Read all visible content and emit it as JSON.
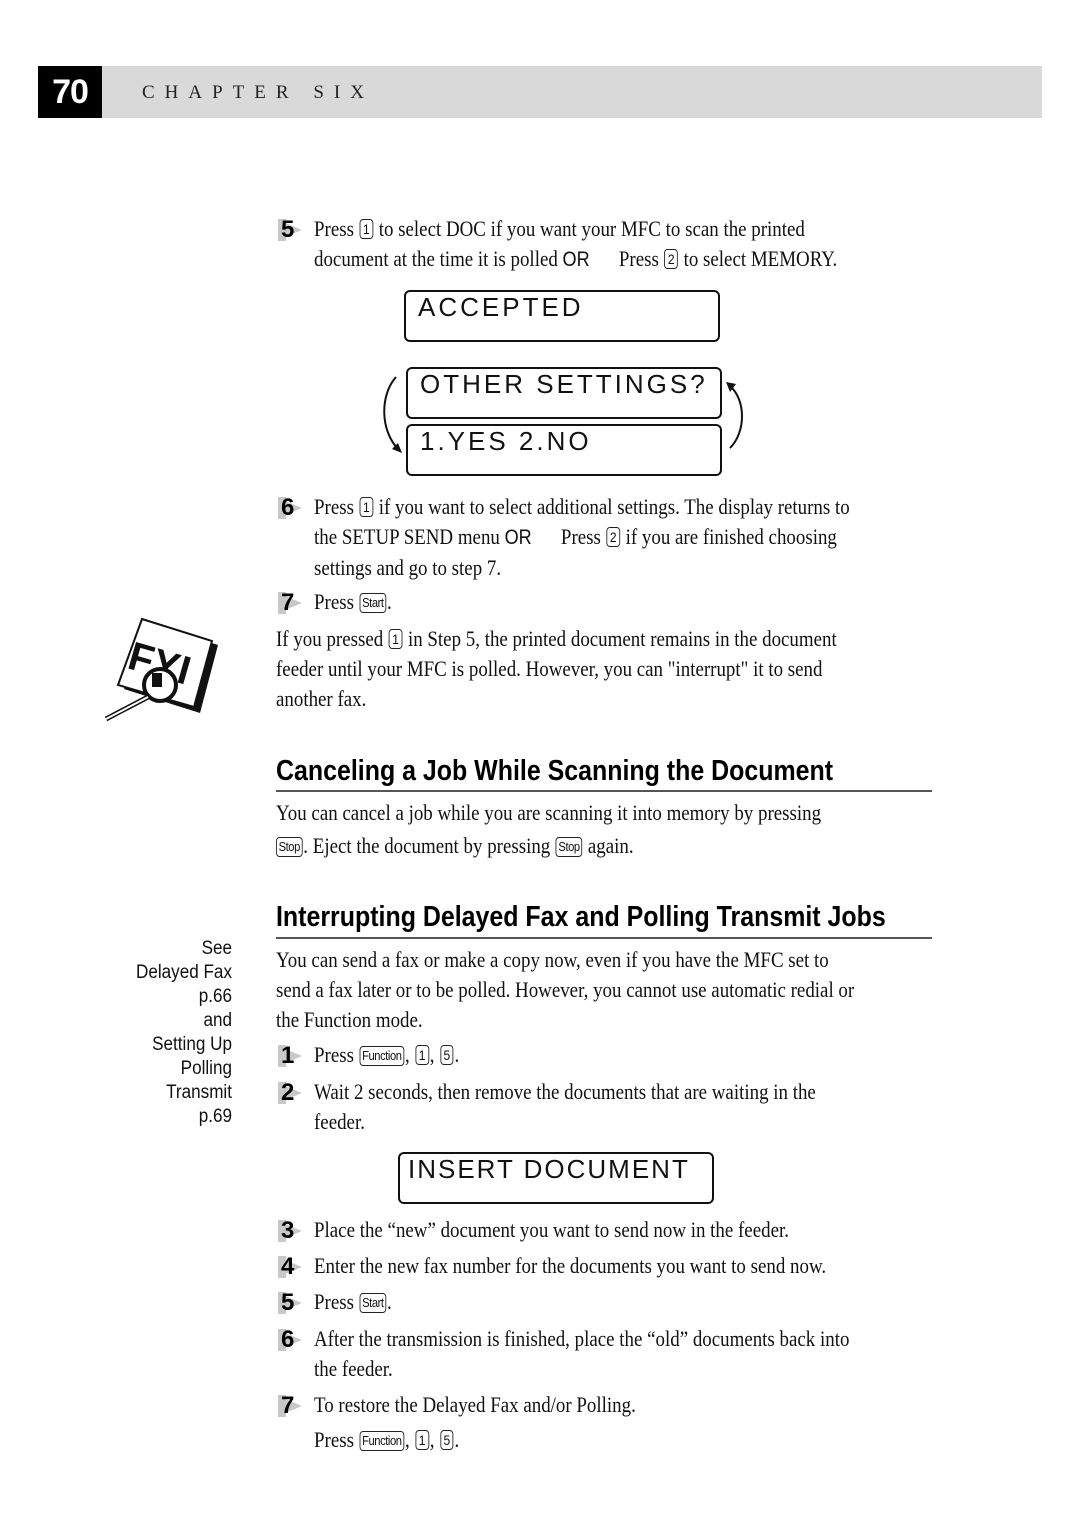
{
  "header": {
    "page_number": "70",
    "chapter_title": "CHAPTER SIX"
  },
  "section_polling": {
    "step5": {
      "number": "5",
      "line1_a": "Press",
      "key1": "1",
      "line1_b": "to select DOC if you want your MFC to scan the printed",
      "line2_a": "document at the time it is polled",
      "or": "OR",
      "line2_b": "Press",
      "key2": "2",
      "line2_c": "to select MEMORY."
    },
    "lcd_accepted": "ACCEPTED",
    "lcd_other_settings": "OTHER SETTINGS?",
    "lcd_yes_no": "1.YES 2.NO",
    "step6": {
      "number": "6",
      "line1_a": "Press",
      "key1": "1",
      "line1_b": "if you want to select additional settings. The display returns to",
      "line2_a": "the SETUP SEND menu",
      "or": "OR",
      "line2_b": "Press",
      "key2": "2",
      "line2_c": "if you are finished choosing",
      "line3": "settings and go to step 7."
    },
    "step7": {
      "number": "7",
      "press": "Press",
      "key": "Start",
      "end": "."
    },
    "fyi_icon": "fyi-magnifier-icon",
    "fyi_note": {
      "line1_a": "If you pressed",
      "key": "1",
      "line1_b": "in Step 5, the printed document remains in the document",
      "line2": "feeder until your MFC is polled.  However, you can \"interrupt\" it to send",
      "line3": "another fax."
    }
  },
  "section_cancel": {
    "heading": "Canceling a Job While Scanning the Document",
    "line1": "You can cancel a job while you are scanning it into memory by pressing",
    "key_stop": "Stop",
    "line2_a": ".  Eject the document by pressing",
    "line2_b": "again."
  },
  "section_interrupt": {
    "heading": "Interrupting Delayed Fax and Polling Transmit Jobs",
    "sidenote": [
      "See",
      "Delayed Fax",
      "p.66",
      "and",
      "Setting Up",
      "Polling",
      "Transmit",
      "p.69"
    ],
    "intro_line1": "You can send a fax or make a copy now, even if you have the MFC set to",
    "intro_line2": "send a fax later or to be polled. However, you cannot use automatic redial or",
    "intro_line3": "the Function mode.",
    "steps": [
      {
        "number": "1",
        "press": "Press",
        "key_function": "Function",
        "key_a": "1",
        "key_b": "5"
      },
      {
        "number": "2",
        "line1": "Wait 2 seconds, then remove the documents that are waiting in the",
        "line2": "feeder."
      },
      {
        "number": "3",
        "line1": "Place the “new” document you want to send now in the feeder."
      },
      {
        "number": "4",
        "line1": "Enter the new fax number for the documents you want to send now."
      },
      {
        "number": "5",
        "press": "Press",
        "key": "Start"
      },
      {
        "number": "6",
        "line1": "After the transmission is finished, place the “old” documents back into",
        "line2": "the feeder."
      },
      {
        "number": "7",
        "line1": "To restore the Delayed Fax and/or Polling.",
        "press": "Press",
        "key_function": "Function",
        "key_a": "1",
        "key_b": "5"
      }
    ],
    "lcd_insert": "INSERT DOCUMENT"
  }
}
